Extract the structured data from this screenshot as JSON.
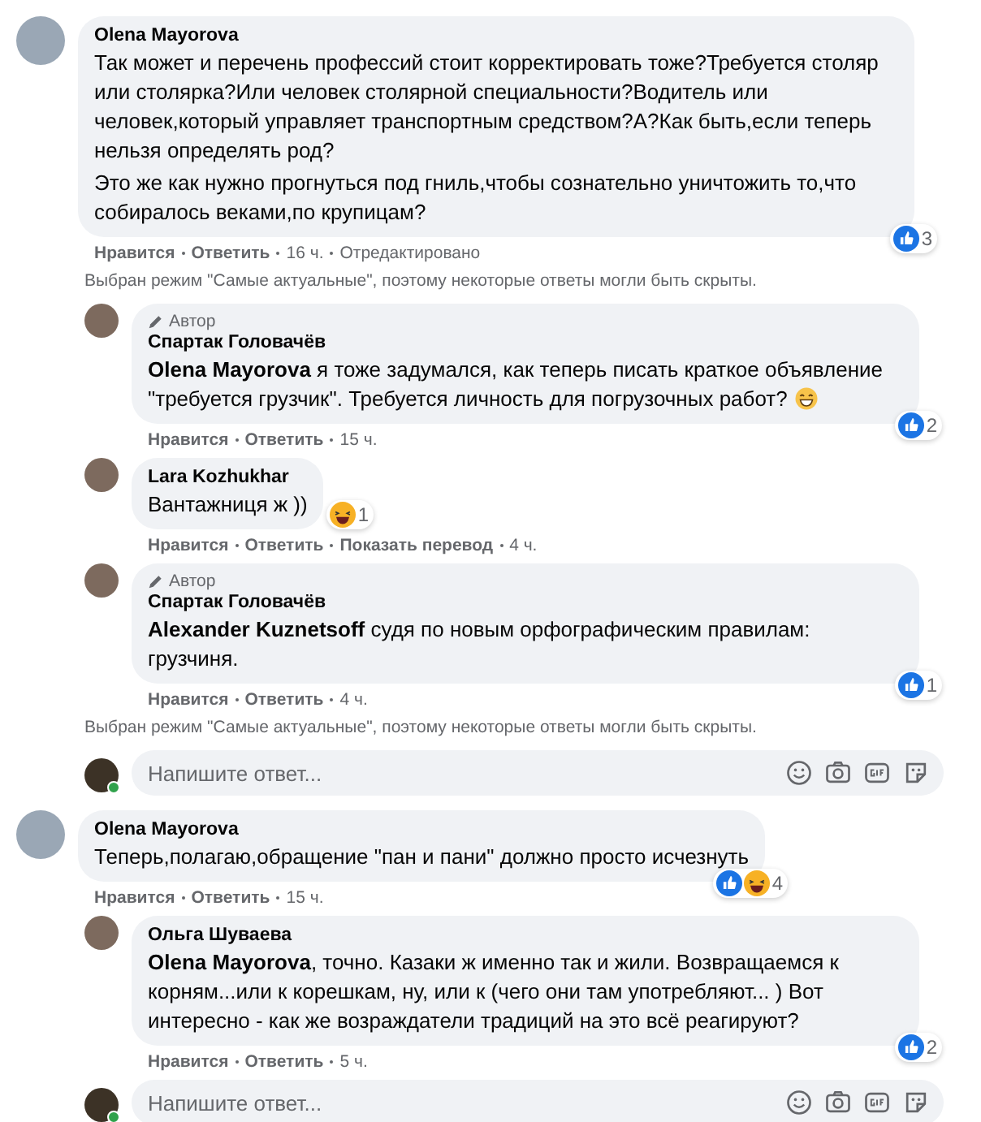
{
  "entries": [
    {
      "kind": "comment",
      "author": "Olena Mayorova",
      "paragraphs": [
        "Так может и перечень профессий стоит корректировать тоже?Требуется столяр или столярка?Или человек столярной специальности?Водитель или человек,который управляет транспортным средством?А?Как быть,если теперь нельзя определять род?",
        "Это же как нужно прогнуться под гниль,чтобы сознательно уничтожить то,что собиралось веками,по крупицам?"
      ],
      "reactions": {
        "kind": "overlay",
        "icons": [
          {
            "kind": "like"
          }
        ],
        "count": "3"
      },
      "actions": [
        {
          "label": "Нравится",
          "kind": "link"
        },
        {
          "label": "Ответить",
          "kind": "link"
        },
        {
          "label": "16 ч.",
          "kind": "meta"
        },
        {
          "label": "Отредактировано",
          "kind": "meta"
        }
      ],
      "replies": [
        {
          "kind": "notice",
          "text": "Выбран режим \"Самые актуальные\", поэтому некоторые ответы могли быть скрыты."
        },
        {
          "kind": "comment",
          "badge": "Автор",
          "author": "Спартак Головачёв",
          "paragraphs": [
            "**Olena Mayorova** я тоже задумался, как теперь писать краткое объявление \"требуется грузчик\". Требуется личность для погрузочных работ?"
          ],
          "emoji": {
            "kind": "grin"
          },
          "reactions": {
            "kind": "overlay",
            "icons": [
              {
                "kind": "like"
              }
            ],
            "count": "2"
          },
          "actions": [
            {
              "label": "Нравится",
              "kind": "link"
            },
            {
              "label": "Ответить",
              "kind": "link"
            },
            {
              "label": "15 ч.",
              "kind": "meta"
            }
          ]
        },
        {
          "kind": "comment",
          "author": "Lara Kozhukhar",
          "paragraphs": [
            "Вантажниця ж ))"
          ],
          "reactions": {
            "kind": "beside",
            "icons": [
              {
                "kind": "haha"
              }
            ],
            "count": "1"
          },
          "actions": [
            {
              "label": "Нравится",
              "kind": "link"
            },
            {
              "label": "Ответить",
              "kind": "link"
            },
            {
              "label": "Показать перевод",
              "kind": "link"
            },
            {
              "label": "4 ч.",
              "kind": "meta"
            }
          ]
        },
        {
          "kind": "comment",
          "badge": "Автор",
          "author": "Спартак Головачёв",
          "paragraphs": [
            "**Alexander Kuznetsoff** судя по новым орфографическим правилам: грузчиня."
          ],
          "reactions": {
            "kind": "overlay",
            "icons": [
              {
                "kind": "like"
              }
            ],
            "count": "1"
          },
          "actions": [
            {
              "label": "Нравится",
              "kind": "link"
            },
            {
              "label": "Ответить",
              "kind": "link"
            },
            {
              "label": "4 ч.",
              "kind": "meta"
            }
          ]
        },
        {
          "kind": "notice",
          "text": "Выбран режим \"Самые актуальные\", поэтому некоторые ответы могли быть скрыты."
        },
        {
          "kind": "input",
          "placeholder": "Напишите ответ..."
        }
      ]
    },
    {
      "kind": "comment",
      "author": "Olena Mayorova",
      "paragraphs": [
        "Теперь,полагаю,обращение \"пан и пани\" должно просто исчезнуть"
      ],
      "reactions": {
        "kind": "overlay",
        "icons": [
          {
            "kind": "like"
          },
          {
            "kind": "haha"
          }
        ],
        "count": "4"
      },
      "actions": [
        {
          "label": "Нравится",
          "kind": "link"
        },
        {
          "label": "Ответить",
          "kind": "link"
        },
        {
          "label": "15 ч.",
          "kind": "meta"
        }
      ],
      "replies": [
        {
          "kind": "comment",
          "author": "Ольга Шуваева",
          "paragraphs": [
            "**Olena Mayorova**, точно. Казаки ж именно так и жили. Возвращаемся к корням...или к корешкам, ну, или к (чего они там употребляют... ) Вот интересно - как же возраждатели традиций на это всё реагируют?"
          ],
          "reactions": {
            "kind": "overlay",
            "icons": [
              {
                "kind": "like"
              }
            ],
            "count": "2"
          },
          "actions": [
            {
              "label": "Нравится",
              "kind": "link"
            },
            {
              "label": "Ответить",
              "kind": "link"
            },
            {
              "label": "5 ч.",
              "kind": "meta"
            }
          ]
        },
        {
          "kind": "input",
          "placeholder": "Напишите ответ..."
        }
      ]
    }
  ]
}
